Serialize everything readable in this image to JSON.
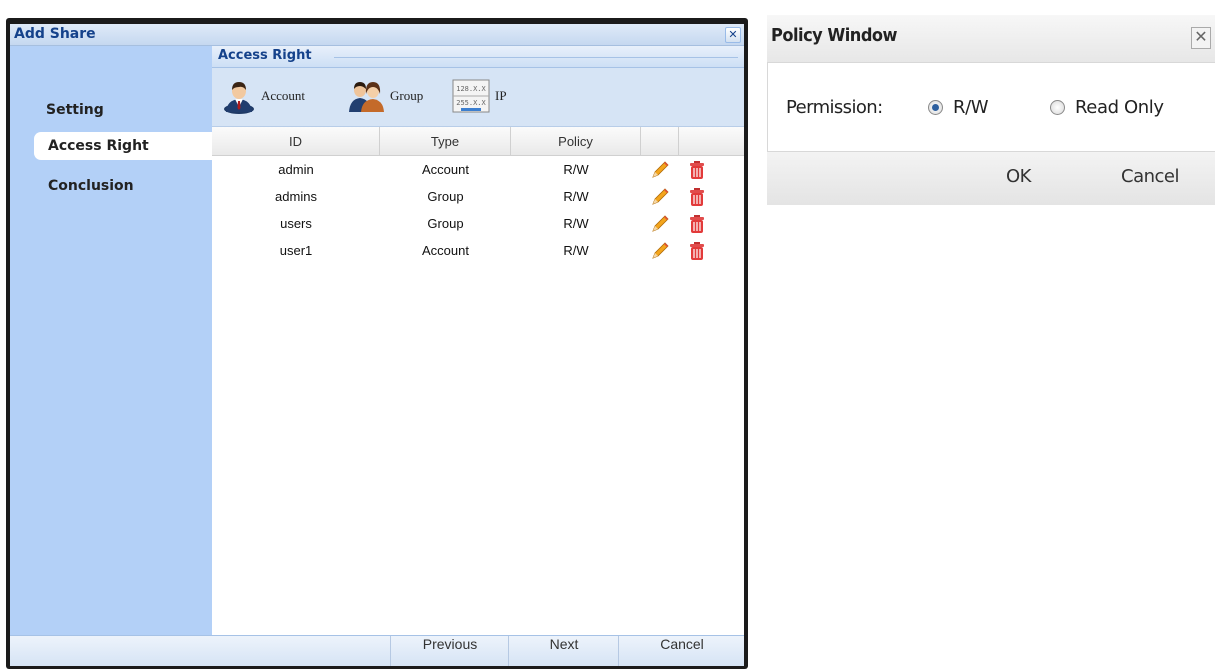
{
  "add_share": {
    "title": "Add Share",
    "close_glyph": "✕",
    "sidebar": {
      "items": [
        {
          "label": "Setting",
          "selected": false
        },
        {
          "label": "Access Right",
          "selected": true
        },
        {
          "label": "Conclusion",
          "selected": false
        }
      ]
    },
    "section_title": "Access Right",
    "toolbar": {
      "account_label": "Account",
      "group_label": "Group",
      "ip_label": "IP",
      "ip_icon_line1": "128.X.X",
      "ip_icon_line2": "255.X.X"
    },
    "grid": {
      "headers": [
        "ID",
        "Type",
        "Policy",
        "",
        ""
      ],
      "rows": [
        {
          "id": "admin",
          "type": "Account",
          "policy": "R/W"
        },
        {
          "id": "admins",
          "type": "Group",
          "policy": "R/W"
        },
        {
          "id": "users",
          "type": "Group",
          "policy": "R/W"
        },
        {
          "id": "user1",
          "type": "Account",
          "policy": "R/W"
        }
      ],
      "row_icons": [
        "pencil-icon",
        "trash-icon"
      ]
    },
    "footer": {
      "previous_label": "Previous",
      "next_label": "Next",
      "cancel_label": "Cancel"
    },
    "colors": {
      "title_text": "#15428b",
      "sidebar_bg": "#b3d0f7",
      "toolbar_bg": "#d6e4f5"
    }
  },
  "policy_window": {
    "title": "Policy Window",
    "close_glyph": "✕",
    "permission_label": "Permission:",
    "options": [
      {
        "label": "R/W",
        "selected": true
      },
      {
        "label": "Read Only",
        "selected": false
      }
    ],
    "ok_label": "OK",
    "cancel_label": "Cancel"
  }
}
